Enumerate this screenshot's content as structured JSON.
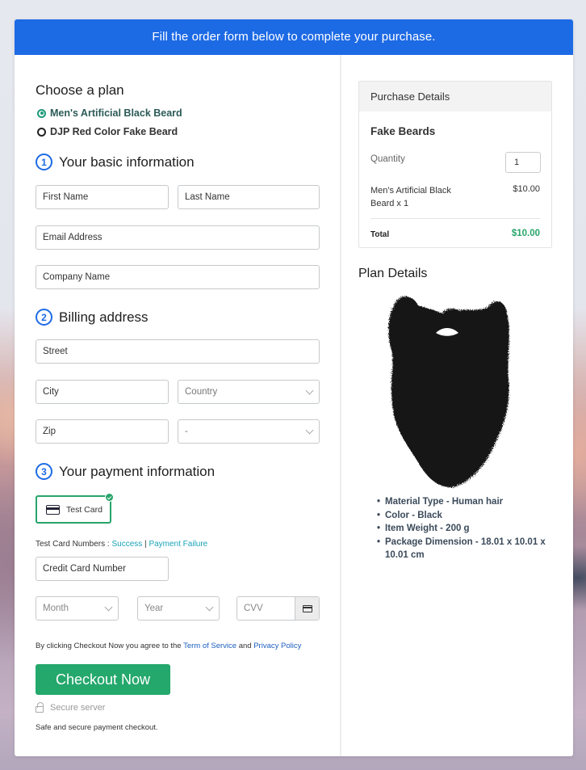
{
  "banner": {
    "text": "Fill the order form below to complete your purchase."
  },
  "plan": {
    "heading": "Choose a plan",
    "options": [
      {
        "label": "Men's Artificial Black Beard",
        "selected": true
      },
      {
        "label": "DJP Red Color Fake Beard",
        "selected": false
      }
    ]
  },
  "basic_info": {
    "number": "1",
    "title": "Your basic information",
    "first_name_placeholder": "First Name",
    "last_name_placeholder": "Last Name",
    "email_placeholder": "Email Address",
    "company_placeholder": "Company Name"
  },
  "billing": {
    "number": "2",
    "title": "Billing address",
    "street_placeholder": "Street",
    "city_placeholder": "City",
    "country_selected": "Country",
    "zip_placeholder": "Zip",
    "state_selected": "-"
  },
  "payment": {
    "number": "3",
    "title": "Your payment information",
    "method_label": "Test Card",
    "test_numbers_label": "Test Card Numbers : ",
    "success_link": "Success",
    "separator": " | ",
    "failure_link": "Payment Failure",
    "card_number_placeholder": "Credit Card Number",
    "month_selected": "Month",
    "year_selected": "Year",
    "cvv_placeholder": "CVV"
  },
  "agreement": {
    "prefix": "By clicking Checkout Now you agree to the ",
    "terms_link": "Term of Service",
    "middle": " and ",
    "privacy_link": "Privacy Policy"
  },
  "checkout": {
    "button_label": "Checkout Now",
    "secure_label": "Secure server",
    "safe_text": "Safe and secure payment checkout."
  },
  "purchase_details": {
    "heading": "Purchase Details",
    "product_title": "Fake Beards",
    "quantity_label": "Quantity",
    "quantity_value": "1",
    "item_label": "Men's Artificial Black Beard x 1",
    "item_price": "$10.00",
    "total_label": "Total",
    "total_value": "$10.00"
  },
  "plan_details": {
    "heading": "Plan Details",
    "image_alt": "black-beard-image",
    "features": [
      "Material Type - Human hair",
      "Color - Black",
      "Item Weight  - 200 g",
      "Package Dimension - 18.01 x 10.01 x 10.01 cm"
    ]
  },
  "colors": {
    "brand_blue": "#1d6ae5",
    "success_green": "#24a86c",
    "link_teal": "#1aa3b8",
    "link_blue": "#1d5fbf"
  }
}
